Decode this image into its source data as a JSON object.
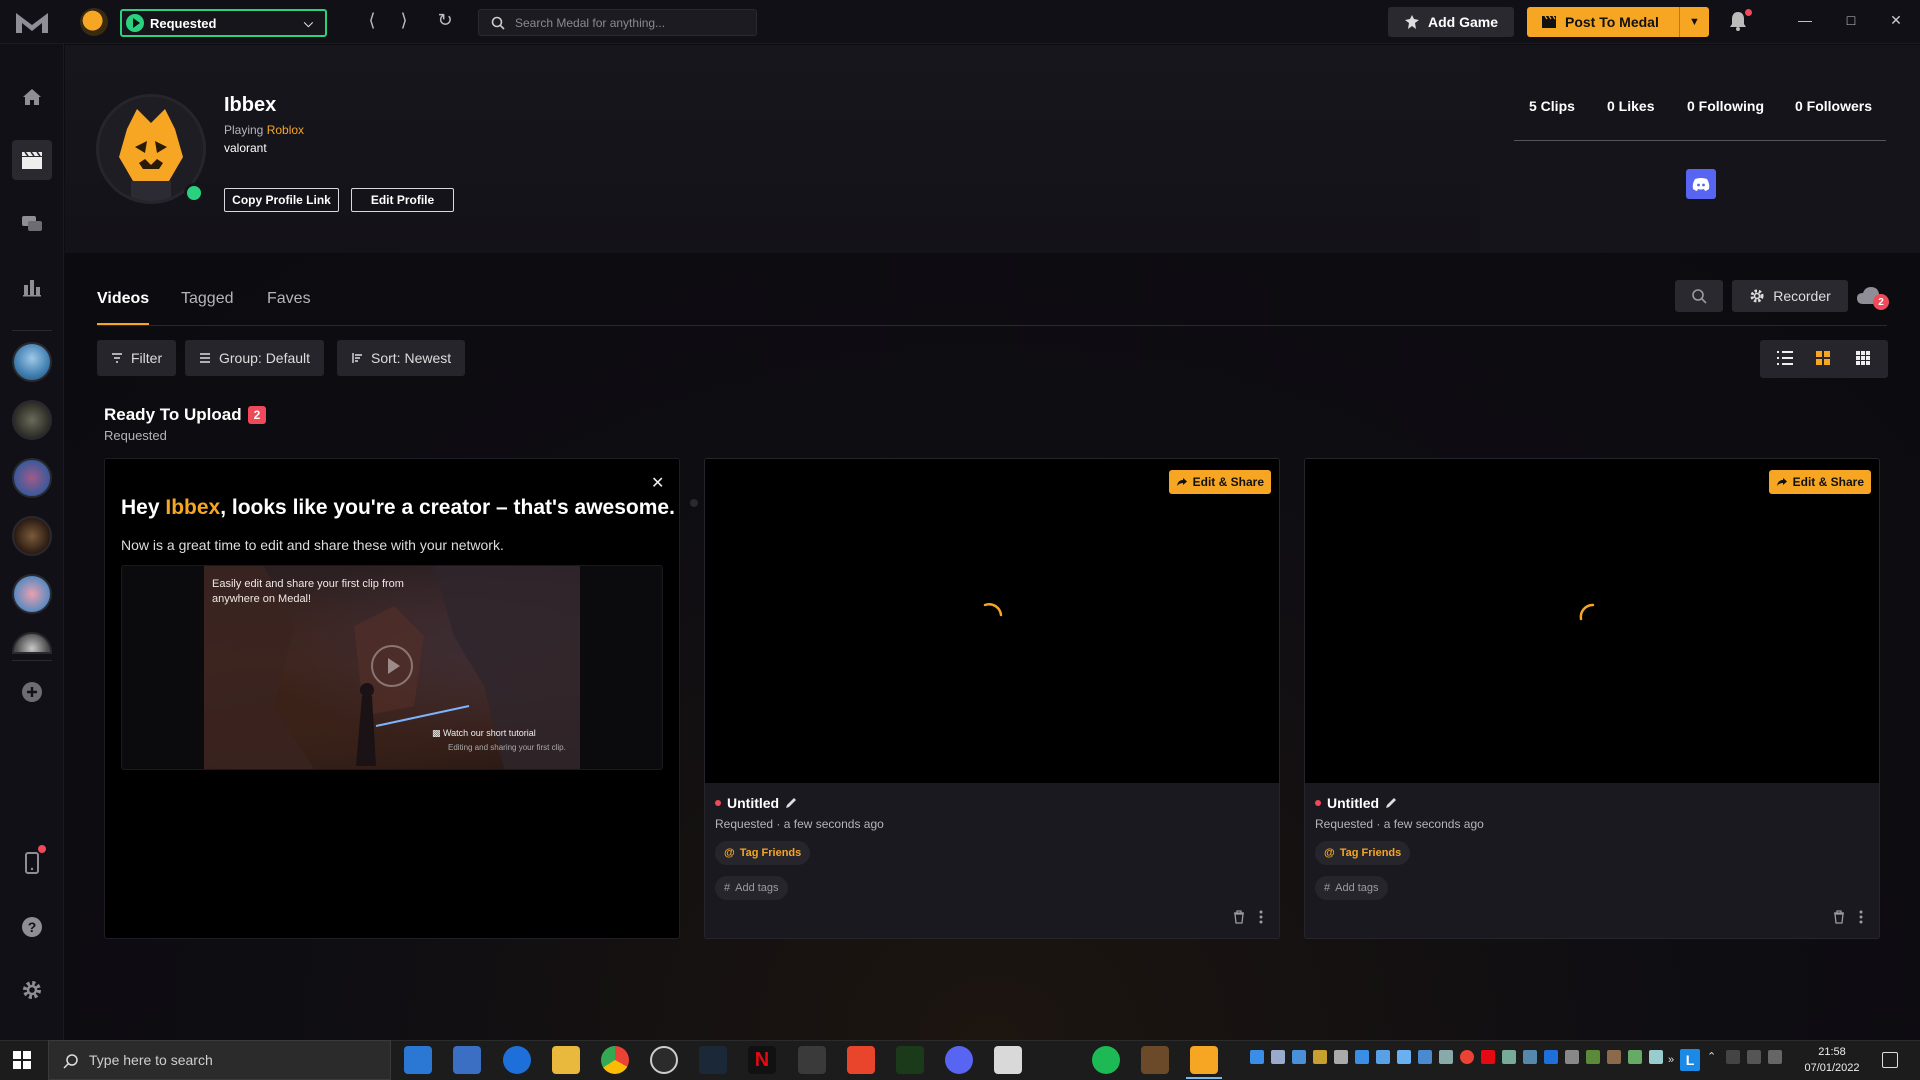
{
  "titlebar": {
    "status": "Requested",
    "search_placeholder": "Search Medal for anything...",
    "add_game_label": "Add Game",
    "post_label": "Post To Medal"
  },
  "profile": {
    "username": "Ibbex",
    "playing_prefix": "Playing",
    "playing_game": "Roblox",
    "status_message": "valorant",
    "copy_link_label": "Copy Profile Link",
    "edit_profile_label": "Edit Profile",
    "stats": {
      "clips": "5 Clips",
      "likes": "0 Likes",
      "following": "0 Following",
      "followers": "0 Followers"
    }
  },
  "tabs": [
    "Videos",
    "Tagged",
    "Faves"
  ],
  "toolbar": {
    "recorder_label": "Recorder",
    "cloud_count": "2",
    "filter_label": "Filter",
    "group_label": "Group: Default",
    "sort_label": "Sort: Newest"
  },
  "section": {
    "title": "Ready To Upload",
    "count": "2",
    "subtitle": "Requested"
  },
  "creator_card": {
    "headline_pre": "Hey ",
    "headline_name": "Ibbex",
    "headline_post": ", looks like you're a creator – that's awesome.",
    "subtext": "Now is a great time to edit and share these with your network.",
    "tutorial_caption": "Easily edit and share your first clip from anywhere on Medal!",
    "tutorial_watch": "Watch our short tutorial",
    "tutorial_watch_sub": "Editing and sharing your first clip."
  },
  "clips": [
    {
      "title": "Untitled",
      "status": "Requested",
      "time": "a few seconds ago",
      "edit_share_label": "Edit & Share",
      "tag_friends_label": "Tag Friends",
      "add_tags_label": "Add tags"
    },
    {
      "title": "Untitled",
      "status": "Requested",
      "time": "a few seconds ago",
      "edit_share_label": "Edit & Share",
      "tag_friends_label": "Tag Friends",
      "add_tags_label": "Add tags"
    }
  ],
  "taskbar": {
    "search_placeholder": "Type here to search",
    "time": "21:58",
    "date": "07/01/2022"
  },
  "colors": {
    "accent": "#f6a623",
    "online": "#2ad17f",
    "alert": "#f04a5a",
    "discord": "#5865f2"
  },
  "icons": [
    "medal-logo",
    "home-icon",
    "clips-icon",
    "chat-icon",
    "stats-icon",
    "add-icon",
    "phone-icon",
    "help-icon",
    "settings-icon",
    "bell-icon",
    "search-icon",
    "gear-icon",
    "cloud-icon",
    "list-view-icon",
    "grid-view-icon",
    "compact-grid-icon",
    "pencil-icon",
    "trash-icon",
    "more-icon",
    "share-icon",
    "discord-icon"
  ]
}
